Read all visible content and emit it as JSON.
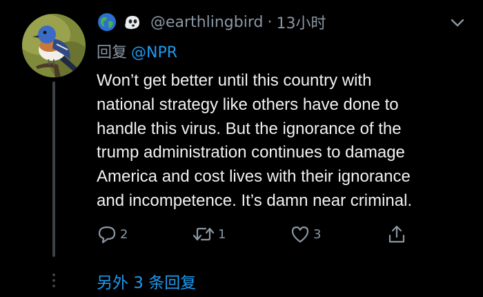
{
  "tweet": {
    "avatar_icon": "bluebird-avatar",
    "author_emoji": [
      "globe-emoji",
      "ghost-emoji"
    ],
    "handle": "@earthlingbird",
    "separator": "·",
    "timestamp": "13小时",
    "reply_prefix": "回复",
    "reply_mention": "@NPR",
    "text_lines": [
      "Won’t get better until this country with",
      "national strategy like others have done to",
      "handle this virus. But the ignorance of the",
      "trump administration continues to damage",
      "America and cost lives with their ignorance",
      "and incompetence. It’s damn near criminal."
    ],
    "actions": {
      "reply_count": "2",
      "retweet_count": "1",
      "like_count": "3"
    },
    "more_replies_label": "另外 3 条回复"
  },
  "colors": {
    "background": "#000000",
    "secondary_text": "#8b98a5",
    "link": "#1d9bf0",
    "thread_line": "#3d4148"
  }
}
